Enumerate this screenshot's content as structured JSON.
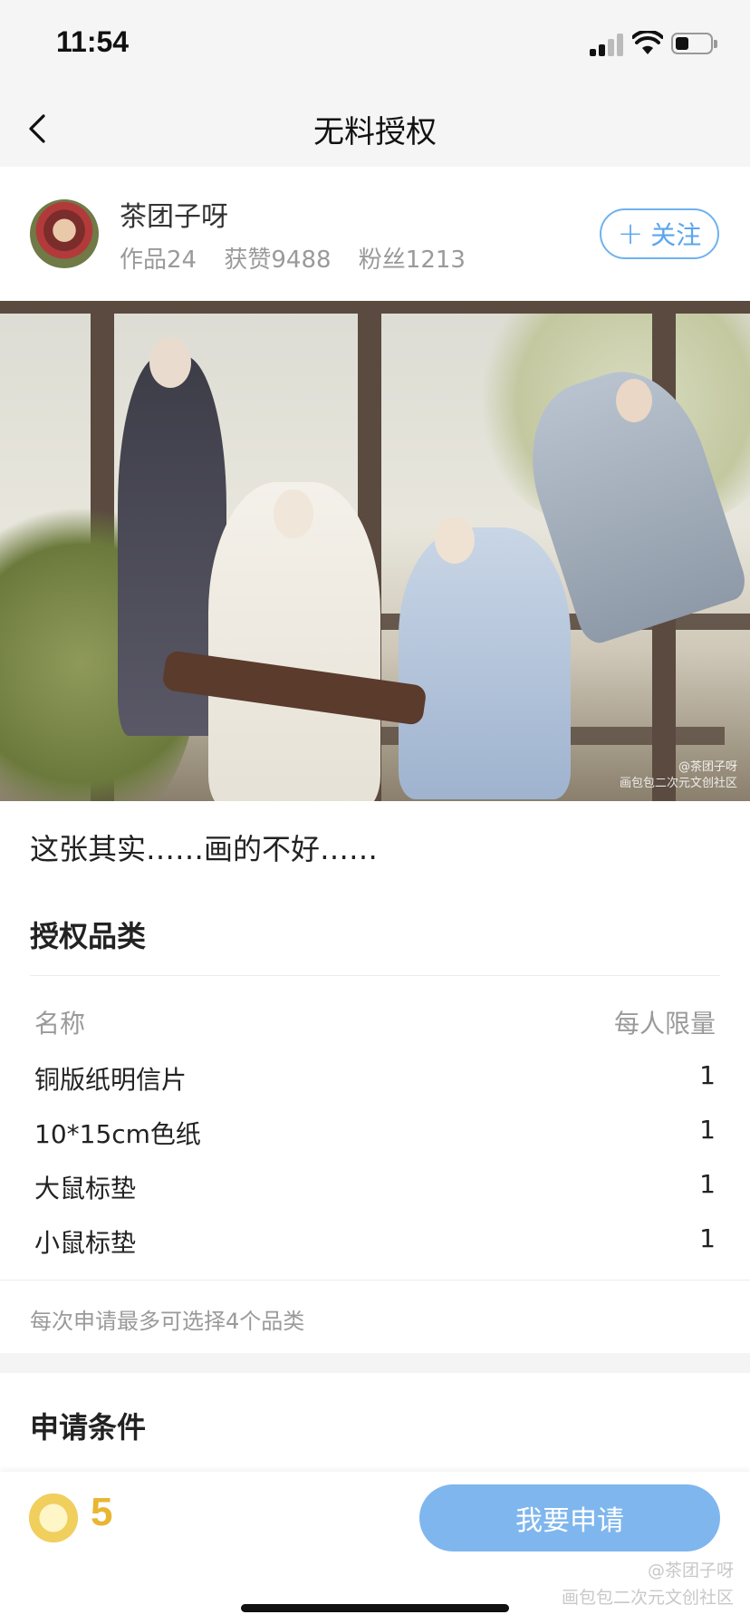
{
  "status_bar": {
    "time": "11:54"
  },
  "nav": {
    "title": "无料授权"
  },
  "author": {
    "name": "茶团子呀",
    "works": "作品24",
    "likes": "获赞9488",
    "fans": "粉丝1213",
    "follow_label": "关注"
  },
  "artwork": {
    "watermark_lines": [
      "@茶团子呀",
      "画包包二次元文创社区"
    ]
  },
  "description": "这张其实……画的不好……",
  "categories": {
    "title": "授权品类",
    "header_name": "名称",
    "header_limit": "每人限量",
    "items": [
      {
        "name": "铜版纸明信片",
        "qty": "1"
      },
      {
        "name": "10*15cm色纸",
        "qty": "1"
      },
      {
        "name": "大鼠标垫",
        "qty": "1"
      },
      {
        "name": "小鼠标垫",
        "qty": "1"
      }
    ],
    "note": "每次申请最多可选择4个品类"
  },
  "conditions": {
    "title": "申请条件"
  },
  "bottom_bar": {
    "coin_value": "5",
    "apply_label": "我要申请",
    "watermark_lines": [
      "@茶团子呀",
      "画包包二次元文创社区"
    ]
  },
  "colors": {
    "accent": "#5aa6ec",
    "apply_button": "#7fb6ee",
    "coin": "#e9b632"
  }
}
